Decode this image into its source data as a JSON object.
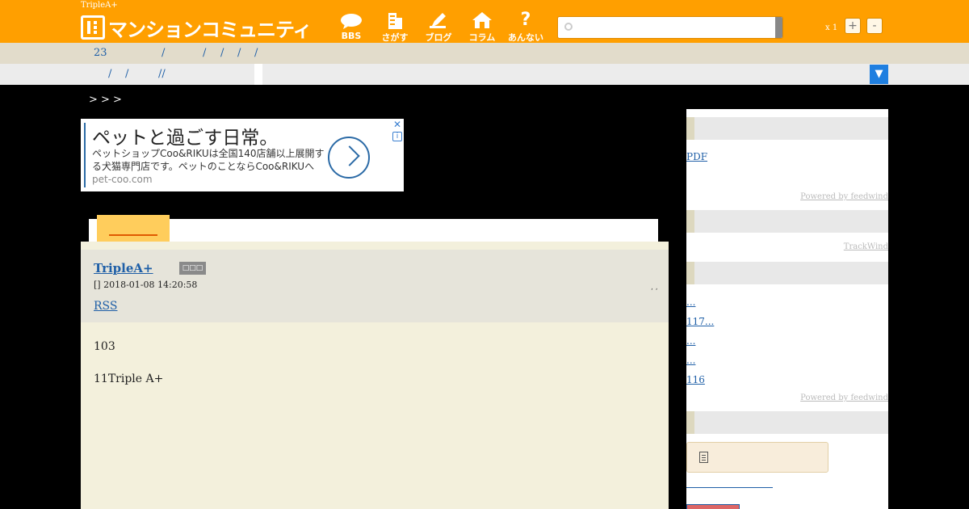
{
  "header": {
    "tiny_title": "TripleA+",
    "logo_text": "マンションコミュニティ",
    "nav": [
      {
        "label": "BBS",
        "icon": "bbs-icon"
      },
      {
        "label": "さがす",
        "icon": "building-icon"
      },
      {
        "label": "ブログ",
        "icon": "pen-icon"
      },
      {
        "label": "コラム",
        "icon": "house-icon"
      },
      {
        "label": "あんない",
        "icon": "question-icon"
      }
    ],
    "zoom": {
      "label": "x 1",
      "plus": "+",
      "minus": "-"
    }
  },
  "breadcrumb1": {
    "items": [
      "23",
      "/",
      "/",
      "/",
      "/",
      "/"
    ]
  },
  "breadcrumb2": {
    "items": [
      "/",
      "/",
      "//"
    ],
    "dropdown": "▼"
  },
  "topic_path": ">        >   >",
  "ad": {
    "headline": "ペットと過ごす日常。",
    "body": "ペットショップCoo&RIKUは全国140店舗以上展開する犬猫専門店です。ペットのことならCoo&RIKUへ",
    "domain": "pet-coo.com",
    "close": "✕",
    "info": "i"
  },
  "post": {
    "poster": "TripleA+",
    "badge": "□□□",
    "date": "[] 2018-01-08 14:20:58",
    "rss": "RSS",
    "tick": ",  ,",
    "lines": [
      "103",
      "11Triple A+"
    ]
  },
  "sidebar": {
    "pdf": "PDF",
    "powered1": "Powered by feedwind",
    "trackwind": "TrackWind",
    "links": [
      "...",
      "117...",
      "...",
      "...",
      "116"
    ],
    "powered2": "Powered by feedwind"
  },
  "colors": {
    "header": "#ff9f00",
    "link": "#1f5fa7",
    "panel": "#f3f0dc"
  }
}
